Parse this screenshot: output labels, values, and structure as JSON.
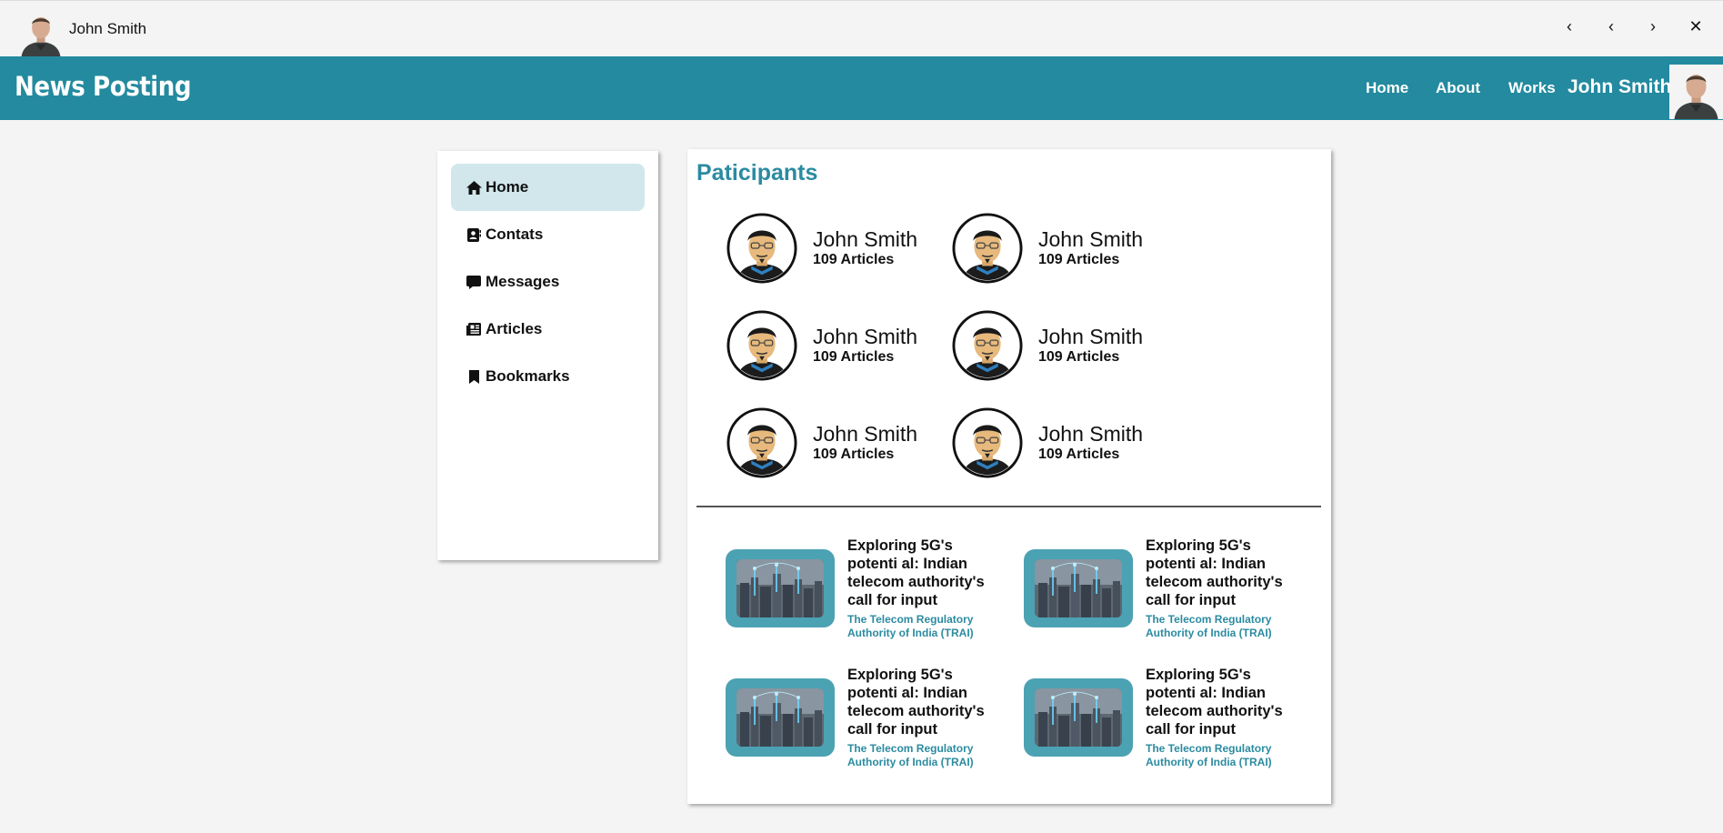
{
  "titlebar": {
    "user_name": "John Smith",
    "buttons": [
      "‹",
      "‹",
      "›",
      "✕"
    ]
  },
  "header": {
    "logo": "News Posting",
    "nav": [
      "Home",
      "About",
      "Works"
    ],
    "user_name": "John Smith",
    "colors": {
      "header_bg": "#238a9f",
      "accent": "#2b8ba0",
      "active_item_bg": "#d1e7ec"
    }
  },
  "sidebar": {
    "items": [
      {
        "label": "Home",
        "icon": "home-icon",
        "active": true
      },
      {
        "label": "Contats",
        "icon": "contacts-icon",
        "active": false
      },
      {
        "label": "Messages",
        "icon": "message-icon",
        "active": false
      },
      {
        "label": "Articles",
        "icon": "newspaper-icon",
        "active": false
      },
      {
        "label": "Bookmarks",
        "icon": "bookmark-icon",
        "active": false
      }
    ]
  },
  "main": {
    "title": "Paticipants",
    "participants": [
      {
        "name": "John Smith",
        "count": "109 Articles"
      },
      {
        "name": "John Smith",
        "count": "109 Articles"
      },
      {
        "name": "John Smith",
        "count": "109 Articles"
      },
      {
        "name": "John Smith",
        "count": "109 Articles"
      },
      {
        "name": "John Smith",
        "count": "109 Articles"
      },
      {
        "name": "John Smith",
        "count": "109 Articles"
      }
    ],
    "articles": [
      {
        "title": "Exploring 5G's potenti al: Indian telecom authority's call for input",
        "source": "The Telecom Regulatory Authority of India (TRAI)"
      },
      {
        "title": "Exploring 5G's potenti al: Indian telecom authority's call for input",
        "source": "The Telecom Regulatory Authority of India (TRAI)"
      },
      {
        "title": "Exploring 5G's potenti al: Indian telecom authority's call for input",
        "source": "The Telecom Regulatory Authority of India (TRAI)"
      },
      {
        "title": "Exploring 5G's potenti al: Indian telecom authority's call for input",
        "source": "The Telecom Regulatory Authority of India (TRAI)"
      }
    ]
  }
}
